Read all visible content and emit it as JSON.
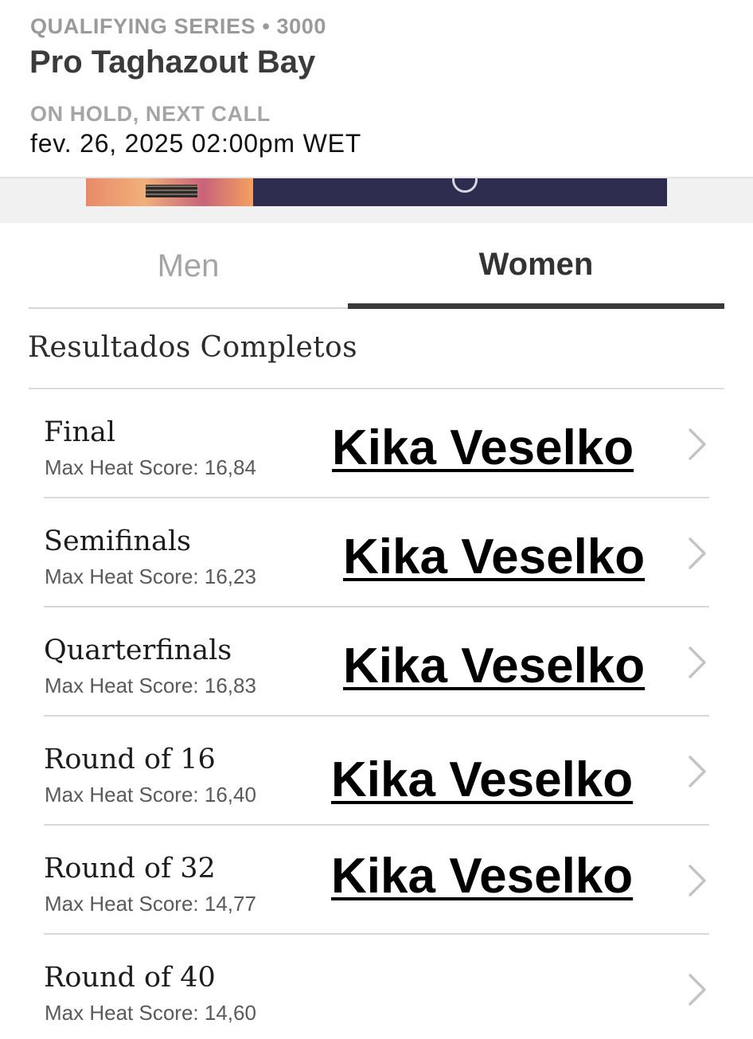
{
  "header": {
    "eyebrow": "QUALIFYING SERIES • 3000",
    "title": "Pro Taghazout Bay",
    "status_label": "ON HOLD, NEXT CALL",
    "status_time": "fev. 26, 2025 02:00pm WET"
  },
  "tabs": [
    {
      "label": "Men",
      "active": false
    },
    {
      "label": "Women",
      "active": true
    }
  ],
  "section_title": "Resultados Completos",
  "rounds": [
    {
      "name": "Final",
      "score": "Max Heat Score: 16,84",
      "winner": "Kika Veselko"
    },
    {
      "name": "Semifinals",
      "score": "Max Heat Score: 16,23",
      "winner": "Kika Veselko"
    },
    {
      "name": "Quarterfinals",
      "score": "Max Heat Score: 16,83",
      "winner": "Kika Veselko"
    },
    {
      "name": "Round of 16",
      "score": "Max Heat Score: 16,40",
      "winner": "Kika Veselko"
    },
    {
      "name": "Round of 32",
      "score": "Max Heat Score: 14,77",
      "winner": "Kika Veselko"
    },
    {
      "name": "Round of 40",
      "score": "Max Heat Score: 14,60",
      "winner": ""
    }
  ],
  "icons": {
    "row_chevron": "chevron-right-icon"
  },
  "colors": {
    "tab_active_underline": "#3a3a3a",
    "tab_inactive_text": "#a4a4a4"
  }
}
